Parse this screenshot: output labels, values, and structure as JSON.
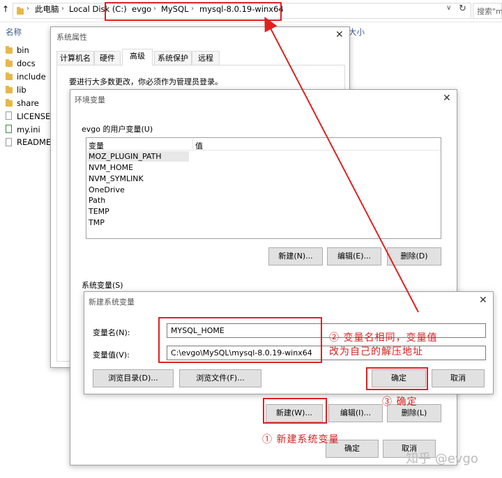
{
  "explorer": {
    "breadcrumbs": [
      "此电脑",
      "Local Disk (C:)",
      "evgo",
      "MySQL",
      "mysql-8.0.19-winx64"
    ],
    "search_placeholder": "搜索\"m",
    "col_name": "名称",
    "col_size": "大小",
    "files": [
      {
        "name": "bin",
        "type": "folder"
      },
      {
        "name": "docs",
        "type": "folder"
      },
      {
        "name": "include",
        "type": "folder"
      },
      {
        "name": "lib",
        "type": "folder"
      },
      {
        "name": "share",
        "type": "folder"
      },
      {
        "name": "LICENSE",
        "type": "file"
      },
      {
        "name": "my.ini",
        "type": "ini"
      },
      {
        "name": "README",
        "type": "file"
      }
    ]
  },
  "sysprops": {
    "title": "系统属性",
    "tabs": [
      "计算机名",
      "硬件",
      "高级",
      "系统保护",
      "远程"
    ],
    "active_tab": "高级",
    "notice": "要进行大多数更改，你必须作为管理员登录。"
  },
  "envvars": {
    "title": "环境变量",
    "user_section": "evgo 的用户变量(U)",
    "col_var": "变量",
    "col_val": "值",
    "user_vars": [
      "MOZ_PLUGIN_PATH",
      "NVM_HOME",
      "NVM_SYMLINK",
      "OneDrive",
      "Path",
      "TEMP",
      "TMP"
    ],
    "user_buttons": {
      "new": "新建(N)...",
      "edit": "编辑(E)...",
      "delete": "删除(D)"
    },
    "sys_section": "系统变量(S)",
    "sys_buttons": {
      "new": "新建(W)...",
      "edit": "编辑(I)...",
      "delete": "删除(L)"
    },
    "ok": "确定",
    "cancel": "取消"
  },
  "newvar": {
    "title": "新建系统变量",
    "name_label": "变量名(N):",
    "name_value": "MYSQL_HOME",
    "value_label": "变量值(V):",
    "value_value": "C:\\evgo\\MySQL\\mysql-8.0.19-winx64",
    "browse_dir": "浏览目录(D)...",
    "browse_file": "浏览文件(F)...",
    "ok": "确定",
    "cancel": "取消"
  },
  "annotations": {
    "step1": "①  新建系统变量",
    "step2_line1": "②  变量名相同，变量值",
    "step2_line2": "改为自己的解压地址",
    "step3": "③  确定",
    "watermark": "知乎 @evgo"
  },
  "colors": {
    "annotation_red": "#e02020",
    "folder_yellow": "#e6b74a"
  }
}
